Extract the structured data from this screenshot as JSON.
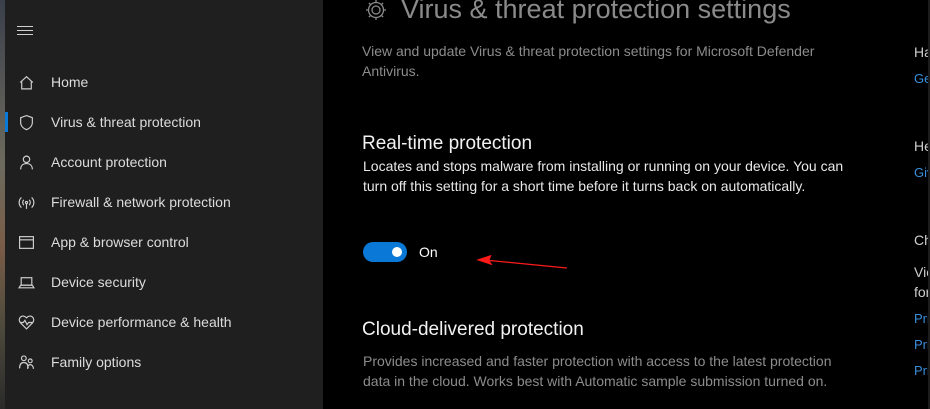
{
  "sidebar": {
    "items": [
      {
        "label": "Home",
        "icon": "home-icon"
      },
      {
        "label": "Virus & threat protection",
        "icon": "shield-icon",
        "active": true
      },
      {
        "label": "Account protection",
        "icon": "person-icon"
      },
      {
        "label": "Firewall & network protection",
        "icon": "wifi-signal-icon"
      },
      {
        "label": "App & browser control",
        "icon": "browser-window-icon"
      },
      {
        "label": "Device security",
        "icon": "laptop-icon"
      },
      {
        "label": "Device performance & health",
        "icon": "heart-icon"
      },
      {
        "label": "Family options",
        "icon": "family-icon"
      }
    ]
  },
  "main": {
    "title": "Virus & threat protection settings",
    "description": "View and update Virus & threat protection settings for Microsoft Defender Antivirus.",
    "realtime": {
      "title": "Real-time protection",
      "description": "Locates and stops malware from installing or running on your device. You can turn off this setting for a short time before it turns back on automatically.",
      "toggle_state": "On"
    },
    "cloud": {
      "title": "Cloud-delivered protection",
      "description": "Provides increased and faster protection with access to the latest protection data in the cloud. Works best with Automatic sample submission turned on."
    }
  },
  "right_panel": {
    "heading1": "Ha",
    "link1": "Ge",
    "heading2": "He",
    "link2": "Giv",
    "heading3": "Ch",
    "text3a": "Vie",
    "text3b": "for",
    "link3a": "Pri",
    "link3b": "Pri",
    "link3c": "Pri"
  },
  "colors": {
    "accent": "#0a78d7",
    "annotation_arrow": "#ff0000",
    "sidebar_bg": "#1f1f1f",
    "main_bg": "#000000"
  }
}
